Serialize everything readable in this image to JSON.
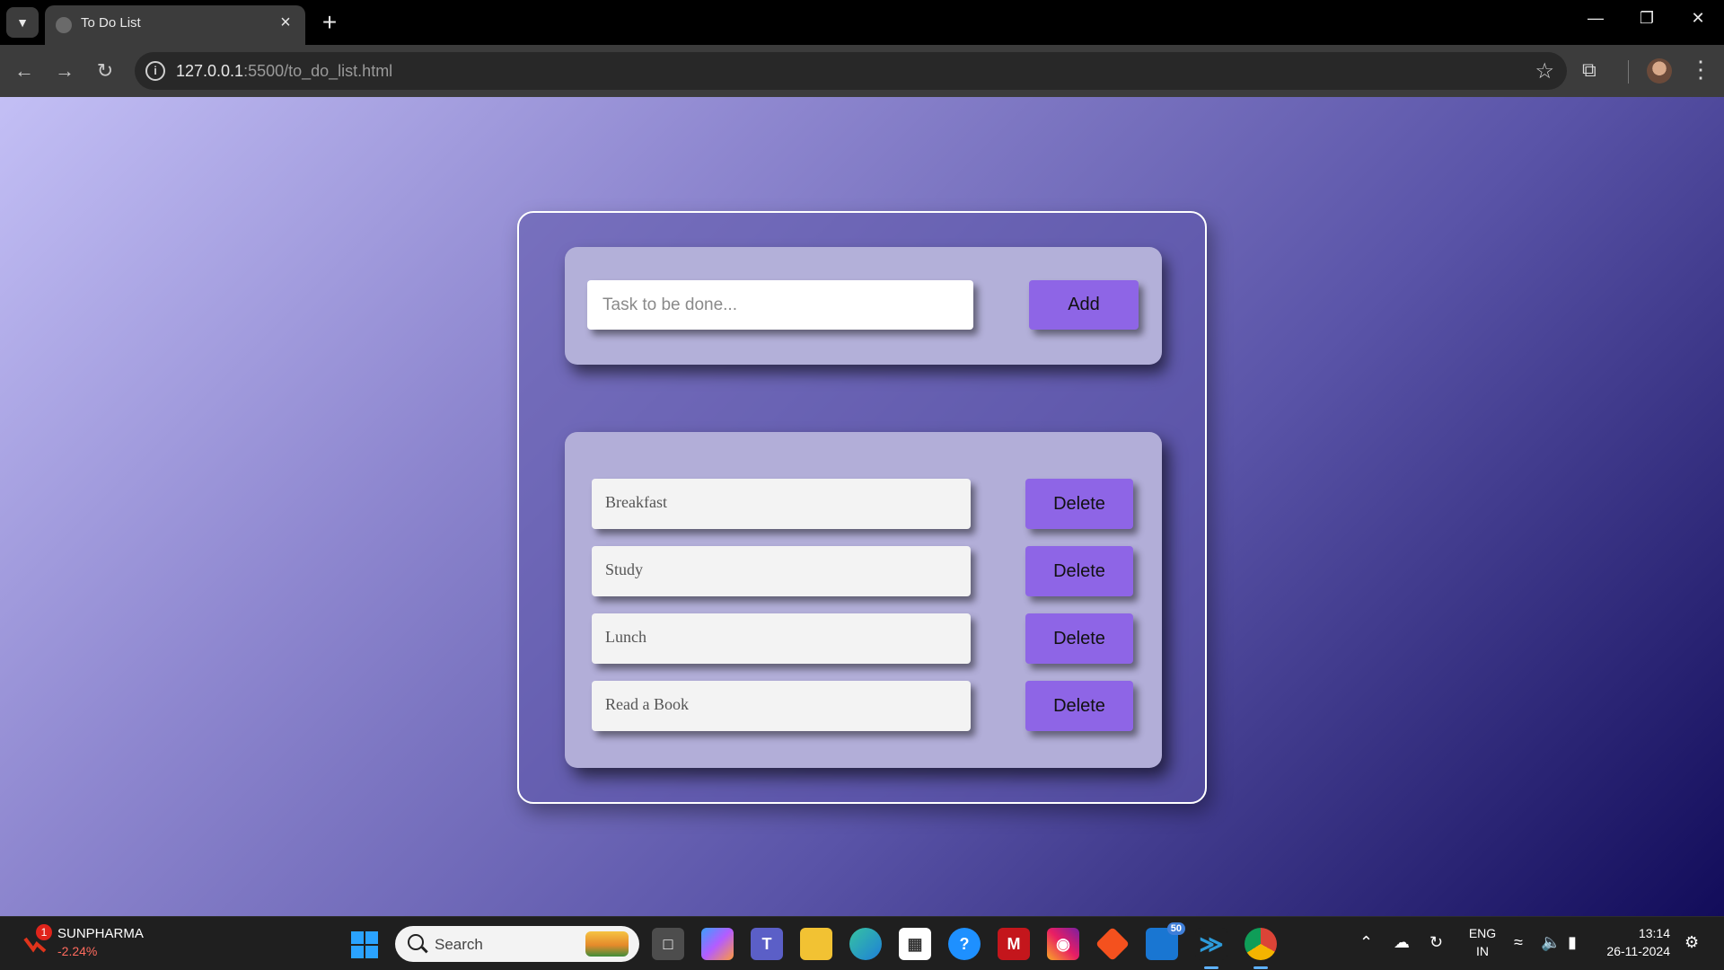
{
  "browser": {
    "tab_title": "To Do List",
    "url_host": "127.0.0.1",
    "url_rest": ":5500/to_do_list.html",
    "icons": [
      "tab-search-icon",
      "favicon-icon",
      "close-icon",
      "plus-icon",
      "minimize-icon",
      "restore-icon",
      "close-window-icon",
      "back-arrow-icon",
      "forward-arrow-icon",
      "reload-icon",
      "info-icon",
      "star-icon",
      "extensions-icon",
      "profile-avatar",
      "more-menu-icon"
    ]
  },
  "todo": {
    "input_placeholder": "Task to be done...",
    "add_label": "Add",
    "tasks": [
      {
        "text": "Breakfast",
        "action": "Delete"
      },
      {
        "text": "Study",
        "action": "Delete"
      },
      {
        "text": "Lunch",
        "action": "Delete"
      },
      {
        "text": "Read a Book",
        "action": "Delete"
      }
    ],
    "colors": {
      "button": "#8e65e6",
      "panel": "#b3b0d9",
      "card_border": "#ffffff"
    }
  },
  "taskbar": {
    "stock_symbol": "SUNPHARMA",
    "stock_change": "-2.24%",
    "stock_badge": "1",
    "search_label": "Search",
    "teams_badge": "50",
    "lang_primary": "ENG",
    "lang_secondary": "IN",
    "time": "13:14",
    "date": "26-11-2024"
  }
}
